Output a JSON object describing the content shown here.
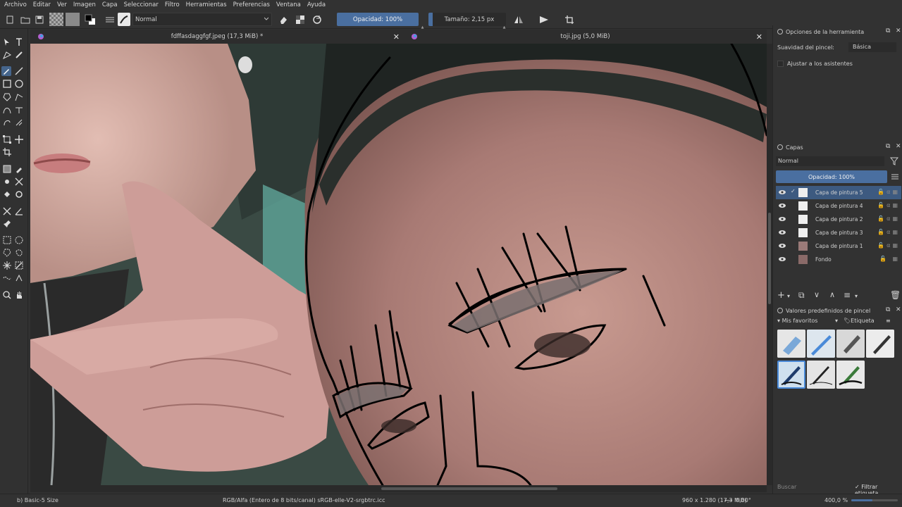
{
  "menu": [
    "Archivo",
    "Editar",
    "Ver",
    "Imagen",
    "Capa",
    "Seleccionar",
    "Filtro",
    "Herramientas",
    "Preferencias",
    "Ventana",
    "Ayuda"
  ],
  "toolbar": {
    "blend_mode": "Normal",
    "opacity_label": "Opacidad: 100%",
    "size_label": "Tamaño: 2,15 px"
  },
  "tabs": [
    {
      "title": "fdffasdaggfgf.jpeg (17,3 MiB) *"
    },
    {
      "title": "toji.jpg (5,0 MiB)"
    }
  ],
  "tool_options": {
    "title": "Opciones de la herramienta",
    "smoothing_label": "Suavidad del pincel:",
    "smoothing_value": "Básica",
    "assistants_label": "Ajustar a los asistentes"
  },
  "layers": {
    "title": "Capas",
    "blend_mode": "Normal",
    "opacity_label": "Opacidad:  100%",
    "items": [
      {
        "name": "Capa de pintura 5",
        "selected": true
      },
      {
        "name": "Capa de pintura 4",
        "selected": false
      },
      {
        "name": "Capa de pintura 2",
        "selected": false
      },
      {
        "name": "Capa de pintura 3",
        "selected": false
      },
      {
        "name": "Capa de pintura 1",
        "selected": false
      },
      {
        "name": "Fondo",
        "selected": false
      }
    ]
  },
  "presets": {
    "title": "Valores predefinidos de pincel",
    "filter": "Mis favoritos",
    "tag_label": "Etiqueta",
    "search_placeholder": "Buscar",
    "filter_tag_label": "Filtrar etiqueta"
  },
  "status": {
    "brush": "b) Basic-5 Size",
    "color_profile": "RGB/Alfa (Entero de 8 bits/canal)  sRGB-elle-V2-srgbtrc.icc",
    "dimensions": "960 x 1.280 (17,3 MiB)",
    "rotation": "0,00°",
    "zoom": "400,0 %"
  },
  "colors": {
    "accent": "#4a6fa0",
    "panel": "#323232",
    "selected_layer": "#3d5a80"
  }
}
